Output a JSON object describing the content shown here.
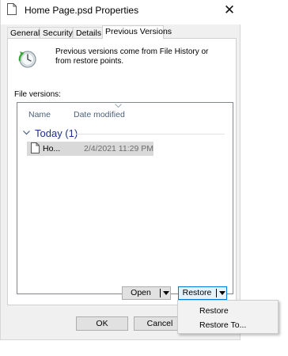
{
  "window": {
    "title": "Home Page.psd Properties",
    "close_glyph": "✕"
  },
  "tabs": [
    {
      "label": "General",
      "active": false
    },
    {
      "label": "Security",
      "active": false
    },
    {
      "label": "Details",
      "active": false
    },
    {
      "label": "Previous Versions",
      "active": true
    }
  ],
  "panel": {
    "info_text": "Previous versions come from File History or from restore points.",
    "file_versions_label": "File versions:",
    "columns": {
      "name": "Name",
      "date_modified": "Date modified"
    },
    "group": {
      "title": "Today (1)"
    },
    "rows": [
      {
        "name": "Ho...",
        "date": "2/4/2021 11:29 PM",
        "selected": true
      }
    ]
  },
  "buttons": {
    "open": "Open",
    "restore": "Restore",
    "ok": "OK",
    "cancel": "Cancel"
  },
  "restore_menu": {
    "items": [
      "Restore",
      "Restore To..."
    ]
  },
  "icons": {
    "title": "document-icon",
    "history": "clock-history-icon",
    "row": "document-icon",
    "group_toggle": "chevron-down-icon"
  },
  "colors": {
    "window_bg": "#f0f0f0",
    "group_title": "#1e3287",
    "column_header": "#4c607a",
    "selected_row": "#d9d9d9",
    "focus_border": "#0078d7"
  }
}
